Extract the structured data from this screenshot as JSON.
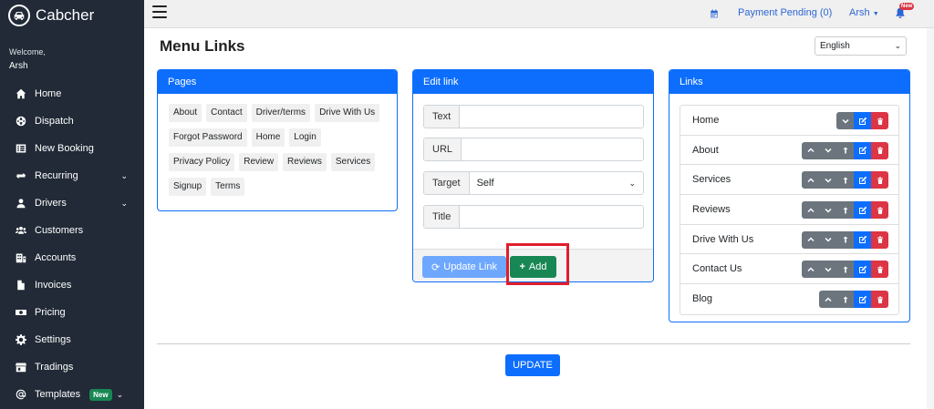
{
  "app": {
    "name": "Cabcher"
  },
  "sidebar": {
    "welcome": "Welcome,",
    "user": "Arsh",
    "items": [
      {
        "label": "Home",
        "icon": "home-icon"
      },
      {
        "label": "Dispatch",
        "icon": "globe-icon"
      },
      {
        "label": "New Booking",
        "icon": "list-icon"
      },
      {
        "label": "Recurring",
        "icon": "repeat-icon",
        "has_chevron": true
      },
      {
        "label": "Drivers",
        "icon": "user-icon",
        "has_chevron": true
      },
      {
        "label": "Customers",
        "icon": "users-icon"
      },
      {
        "label": "Accounts",
        "icon": "building-icon"
      },
      {
        "label": "Invoices",
        "icon": "file-icon"
      },
      {
        "label": "Pricing",
        "icon": "money-icon"
      },
      {
        "label": "Settings",
        "icon": "gear-icon"
      },
      {
        "label": "Tradings",
        "icon": "store-icon"
      },
      {
        "label": "Templates",
        "icon": "at-icon",
        "badge": "New",
        "has_chevron": true
      }
    ]
  },
  "topbar": {
    "payment_pending": "Payment Pending (0)",
    "user": "Arsh",
    "bell_badge": "New"
  },
  "page": {
    "title": "Menu Links",
    "language": "English",
    "update_button": "UPDATE"
  },
  "pages_card": {
    "title": "Pages",
    "tags": [
      "About",
      "Contact",
      "Driver/terms",
      "Drive With Us",
      "Forgot Password",
      "Home",
      "Login",
      "Privacy Policy",
      "Review",
      "Reviews",
      "Services",
      "Signup",
      "Terms"
    ]
  },
  "edit_card": {
    "title": "Edit link",
    "fields": {
      "text_label": "Text",
      "text_value": "",
      "url_label": "URL",
      "url_value": "",
      "target_label": "Target",
      "target_value": "Self",
      "title_label": "Title",
      "title_value": ""
    },
    "update_link_button": "Update Link",
    "add_button": "Add"
  },
  "links_card": {
    "title": "Links",
    "links": [
      {
        "label": "Home",
        "actions": [
          "down",
          "edit",
          "delete"
        ]
      },
      {
        "label": "About",
        "actions": [
          "up",
          "down",
          "outdent",
          "edit",
          "delete"
        ]
      },
      {
        "label": "Services",
        "actions": [
          "up",
          "down",
          "outdent",
          "edit",
          "delete"
        ]
      },
      {
        "label": "Reviews",
        "actions": [
          "up",
          "down",
          "outdent",
          "edit",
          "delete"
        ]
      },
      {
        "label": "Drive With Us",
        "actions": [
          "up",
          "down",
          "outdent",
          "edit",
          "delete"
        ]
      },
      {
        "label": "Contact Us",
        "actions": [
          "up",
          "down",
          "outdent",
          "edit",
          "delete"
        ]
      },
      {
        "label": "Blog",
        "actions": [
          "up",
          "outdent",
          "edit",
          "delete"
        ]
      }
    ]
  },
  "colors": {
    "sidebar": "#212a36",
    "primary": "#0d6efd",
    "success": "#198754",
    "danger": "#dc3545",
    "secondary": "#6c757d",
    "highlight": "#e01e2b"
  }
}
